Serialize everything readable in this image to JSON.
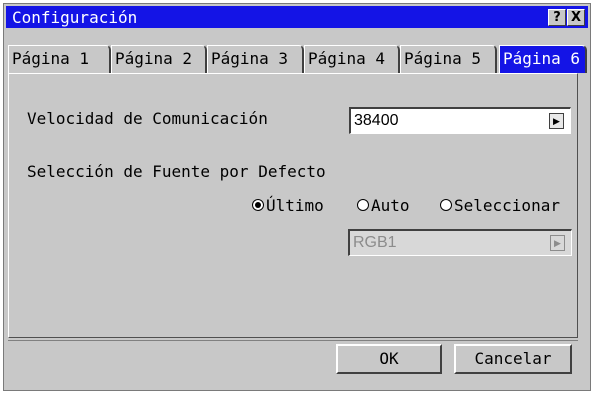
{
  "window": {
    "title": "Configuración",
    "help_label": "?",
    "close_label": "X"
  },
  "tabs": [
    {
      "label": "Página 1",
      "active": false
    },
    {
      "label": "Página 2",
      "active": false
    },
    {
      "label": "Página 3",
      "active": false
    },
    {
      "label": "Página 4",
      "active": false
    },
    {
      "label": "Página 5",
      "active": false
    },
    {
      "label": "Página 6",
      "active": true
    }
  ],
  "comm_speed": {
    "label": "Velocidad de Comunicación",
    "value": "38400"
  },
  "default_source": {
    "label": "Selección de Fuente por Defecto",
    "options": [
      {
        "label": "Último",
        "selected": true
      },
      {
        "label": "Auto",
        "selected": false
      },
      {
        "label": "Seleccionar",
        "selected": false
      }
    ],
    "source_value": "RGB1"
  },
  "buttons": {
    "ok": "OK",
    "cancel": "Cancelar"
  },
  "colors": {
    "titlebar": "#1414e6",
    "face": "#c8c8c8",
    "active_tab": "#1414e6"
  }
}
